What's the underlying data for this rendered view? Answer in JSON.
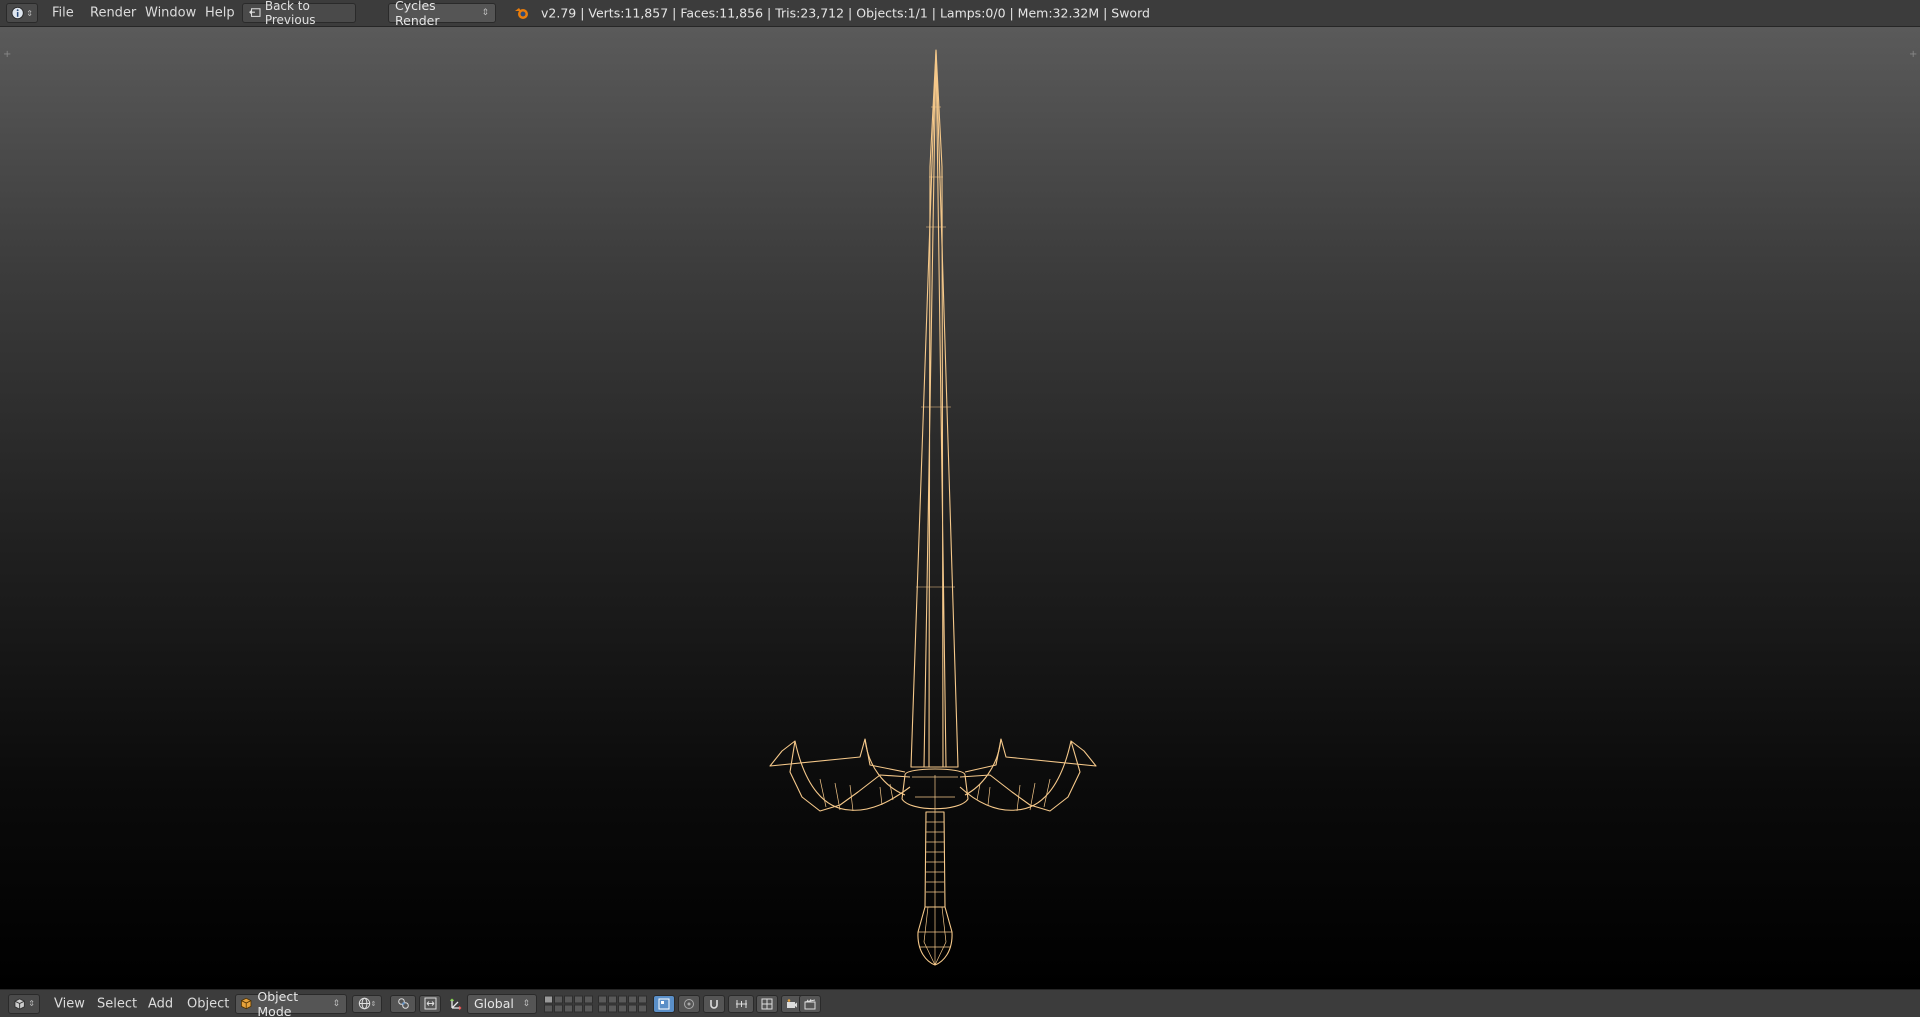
{
  "topbar": {
    "info_icon": "info-icon",
    "menus": [
      "File",
      "Render",
      "Window",
      "Help"
    ],
    "back_button": "Back to Previous",
    "render_engine": "Cycles Render",
    "status": "v2.79 | Verts:11,857 | Faces:11,856 | Tris:23,712 | Objects:1/1 | Lamps:0/0 | Mem:32.32M | Sword"
  },
  "viewport": {
    "object_name": "Sword",
    "wire_color": "#f5c88a",
    "background_top": "#5a5a5a",
    "background_bottom": "#000000"
  },
  "bottombar": {
    "editor_icon": "3d-view-icon",
    "menus": [
      "View",
      "Select",
      "Add",
      "Object"
    ],
    "mode": "Object Mode",
    "transform_orientation": "Global",
    "accent": "#5a8fc8"
  }
}
